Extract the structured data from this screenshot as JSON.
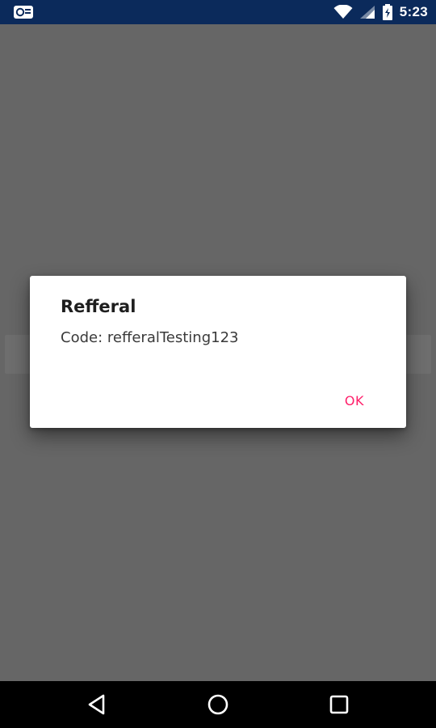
{
  "status_bar": {
    "time": "5:23",
    "icons": [
      "notification-mail-icon",
      "wifi-icon",
      "signal-icon",
      "battery-charging-icon"
    ],
    "background_color": "#0b2a5b"
  },
  "dialog": {
    "title": "Refferal",
    "message": "Code: refferalTesting123",
    "ok_label": "OK",
    "accent_color": "#ff1f6a"
  },
  "nav_bar": {
    "buttons": [
      "back-icon",
      "home-icon",
      "recents-icon"
    ]
  }
}
